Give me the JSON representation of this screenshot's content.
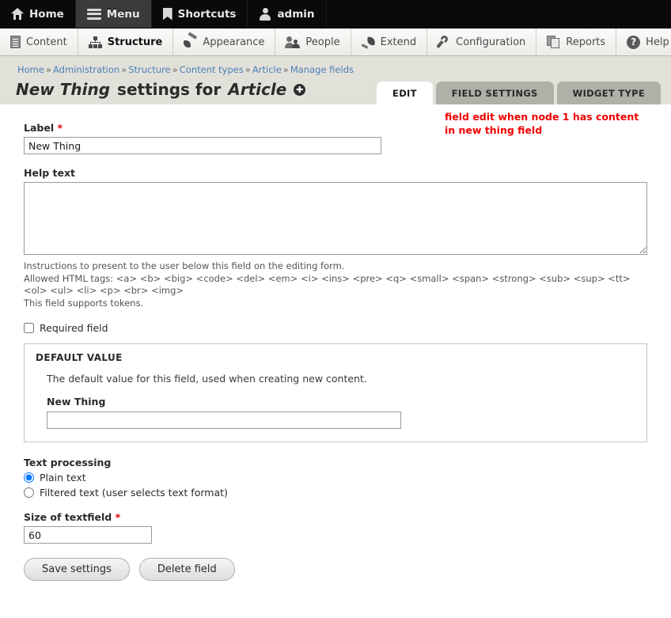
{
  "toolbar": {
    "items": [
      {
        "label": "Home",
        "icon": "home-icon",
        "active": false
      },
      {
        "label": "Menu",
        "icon": "hamburger-icon",
        "active": true
      },
      {
        "label": "Shortcuts",
        "icon": "bookmark-icon",
        "active": false
      },
      {
        "label": "admin",
        "icon": "user-icon",
        "active": false
      }
    ]
  },
  "menubar": {
    "items": [
      {
        "label": "Content",
        "icon": "document-icon"
      },
      {
        "label": "Structure",
        "icon": "sitemap-icon"
      },
      {
        "label": "Appearance",
        "icon": "paintbrush-icon"
      },
      {
        "label": "People",
        "icon": "people-icon"
      },
      {
        "label": "Extend",
        "icon": "plug-icon"
      },
      {
        "label": "Configuration",
        "icon": "wrench-icon"
      },
      {
        "label": "Reports",
        "icon": "pages-icon"
      },
      {
        "label": "Help",
        "icon": "question-mark-icon"
      }
    ],
    "active": "Structure",
    "collapse_icon": "collapse-left-icon"
  },
  "breadcrumb": {
    "items": [
      "Home",
      "Administration",
      "Structure",
      "Content types",
      "Article",
      "Manage fields"
    ],
    "separator": "»"
  },
  "page": {
    "title_field": "New Thing",
    "title_mid": "settings for",
    "title_bundle": "Article",
    "help_icon": "help-circle-icon"
  },
  "tabs": [
    {
      "label": "EDIT",
      "active": true
    },
    {
      "label": "FIELD SETTINGS",
      "active": false
    },
    {
      "label": "WIDGET TYPE",
      "active": false
    }
  ],
  "annotation": "field edit when node 1 has content in new thing field",
  "form": {
    "label": {
      "label": "Label",
      "required_marker": "*",
      "value": "New Thing",
      "placeholder": ""
    },
    "help_text": {
      "label": "Help text",
      "value": "",
      "placeholder": "",
      "desc_line1": "Instructions to present to the user below this field on the editing form.",
      "desc_line2": "Allowed HTML tags: <a> <b> <big> <code> <del> <em> <i> <ins> <pre> <q> <small> <span> <strong> <sub> <sup> <tt> <ol> <ul> <li> <p> <br> <img>",
      "desc_line3": "This field supports tokens."
    },
    "required_field": {
      "label": "Required field",
      "checked": false
    },
    "default_value": {
      "legend": "DEFAULT VALUE",
      "description": "The default value for this field, used when creating new content.",
      "sub_label": "New Thing",
      "value": "",
      "placeholder": ""
    },
    "text_processing": {
      "label": "Text processing",
      "options": [
        {
          "label": "Plain text",
          "selected": true
        },
        {
          "label": "Filtered text (user selects text format)",
          "selected": false
        }
      ]
    },
    "size_of_textfield": {
      "label": "Size of textfield",
      "required_marker": "*",
      "value": "60",
      "placeholder": ""
    },
    "buttons": [
      {
        "label": "Save settings",
        "name": "save-settings-button"
      },
      {
        "label": "Delete field",
        "name": "delete-field-button"
      }
    ]
  },
  "colors": {
    "toolbar_bg": "#0a0a0a",
    "toolbar_active": "#3b3b3b",
    "page_bg": "#e2e1d9",
    "tab_inactive": "#b0b0a8",
    "link": "#4a7eb8",
    "annotation": "#f00000",
    "required": "#e00000"
  }
}
